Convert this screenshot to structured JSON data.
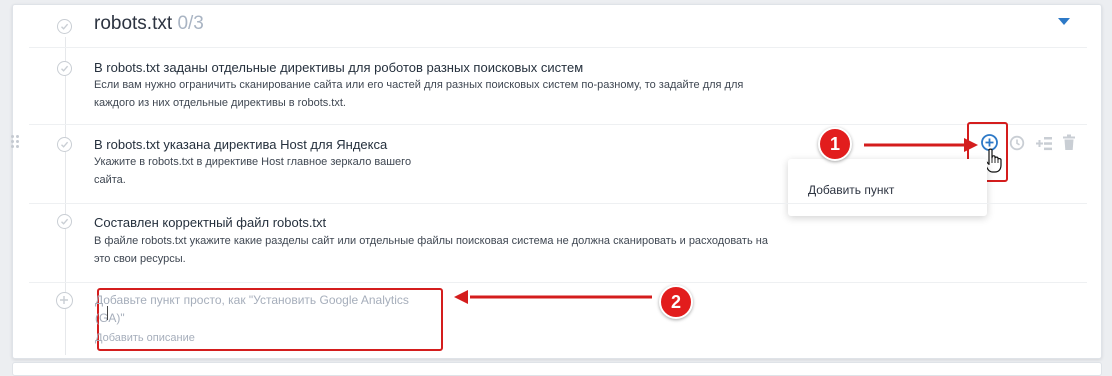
{
  "section": {
    "title": "robots.txt",
    "count": "0/3"
  },
  "items": [
    {
      "title": "В robots.txt заданы отдельные директивы для роботов разных поисковых систем",
      "desc_lines": [
        "Если вам нужно ограничить сканирование сайта или его частей для разных поисковых систем по-разному, то задайте для для",
        "каждого из них отдельные директивы в robots.txt."
      ]
    },
    {
      "title": "В robots.txt указана директива Host для Яндекса",
      "desc_lines": [
        "Укажите в robots.txt в директиве Host главное зеркало вашего",
        "сайта."
      ]
    },
    {
      "title": "Составлен корректный файл robots.txt",
      "desc_lines": [
        "В файле robots.txt укажите какие разделы сайт или отдельные файлы поисковая система не должна сканировать и расходовать на",
        "это свои ресурсы."
      ]
    }
  ],
  "dropdown": {
    "item": "Добавить пункт"
  },
  "new_item": {
    "title_placeholder": "Добавьте пункт просто, как \"Установить Google Analytics (GA)\"",
    "desc_placeholder": "Добавить описание"
  },
  "annotations": {
    "badge1": "1",
    "badge2": "2"
  },
  "icons": [
    "check-circle-icon",
    "drag-handle-icon",
    "add-circle-icon",
    "clock-icon",
    "add-subitem-icon",
    "trash-icon",
    "hand-cursor-icon",
    "caret-down-icon"
  ],
  "colors": {
    "accent": "#2d79c7",
    "annotation": "#d41d1d",
    "muted": "#a6aebb"
  }
}
